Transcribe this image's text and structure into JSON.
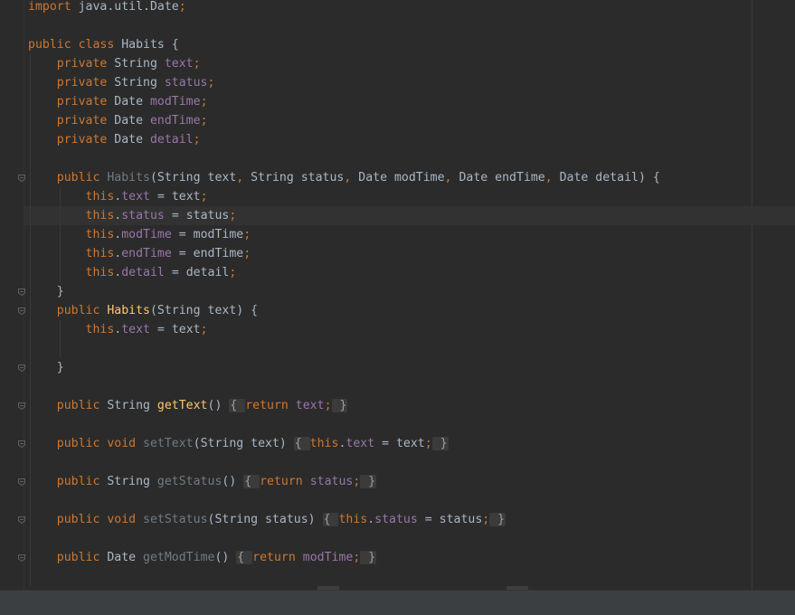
{
  "editor": {
    "lines": [
      [
        {
          "t": "import",
          "c": "kw"
        },
        {
          "t": " java.util.Date",
          "c": "pl"
        },
        {
          "t": ";",
          "c": "kw"
        }
      ],
      [],
      [
        {
          "t": "public class",
          "c": "kw"
        },
        {
          "t": " Habits {",
          "c": "pl"
        }
      ],
      [
        {
          "t": "    private ",
          "c": "kw"
        },
        {
          "t": "String ",
          "c": "pl"
        },
        {
          "t": "text",
          "c": "fld"
        },
        {
          "t": ";",
          "c": "kw"
        }
      ],
      [
        {
          "t": "    private ",
          "c": "kw"
        },
        {
          "t": "String ",
          "c": "pl"
        },
        {
          "t": "status",
          "c": "fld"
        },
        {
          "t": ";",
          "c": "kw"
        }
      ],
      [
        {
          "t": "    private ",
          "c": "kw"
        },
        {
          "t": "Date ",
          "c": "pl"
        },
        {
          "t": "modTime",
          "c": "fld"
        },
        {
          "t": ";",
          "c": "kw"
        }
      ],
      [
        {
          "t": "    private ",
          "c": "kw"
        },
        {
          "t": "Date ",
          "c": "pl"
        },
        {
          "t": "endTime",
          "c": "fld"
        },
        {
          "t": ";",
          "c": "kw"
        }
      ],
      [
        {
          "t": "    private ",
          "c": "kw"
        },
        {
          "t": "Date ",
          "c": "pl"
        },
        {
          "t": "detail",
          "c": "fld"
        },
        {
          "t": ";",
          "c": "kw"
        }
      ],
      [],
      [
        {
          "t": "    public ",
          "c": "kw"
        },
        {
          "t": "Habits",
          "c": "dim"
        },
        {
          "t": "(String text",
          "c": "pl"
        },
        {
          "t": ", ",
          "c": "kw"
        },
        {
          "t": "String status",
          "c": "pl"
        },
        {
          "t": ", ",
          "c": "kw"
        },
        {
          "t": "Date modTime",
          "c": "pl"
        },
        {
          "t": ", ",
          "c": "kw"
        },
        {
          "t": "Date endTime",
          "c": "pl"
        },
        {
          "t": ", ",
          "c": "kw"
        },
        {
          "t": "Date detail) {",
          "c": "pl"
        }
      ],
      [
        {
          "t": "        this",
          "c": "kw"
        },
        {
          "t": ".",
          "c": "pl"
        },
        {
          "t": "text",
          "c": "fld"
        },
        {
          "t": " = text",
          "c": "pl"
        },
        {
          "t": ";",
          "c": "kw"
        }
      ],
      [
        {
          "t": "        this",
          "c": "kw"
        },
        {
          "t": ".",
          "c": "pl"
        },
        {
          "t": "status",
          "c": "fld"
        },
        {
          "t": " = status",
          "c": "pl"
        },
        {
          "t": ";",
          "c": "kw"
        }
      ],
      [
        {
          "t": "        this",
          "c": "kw"
        },
        {
          "t": ".",
          "c": "pl"
        },
        {
          "t": "modTime",
          "c": "fld"
        },
        {
          "t": " = modTime",
          "c": "pl"
        },
        {
          "t": ";",
          "c": "kw"
        }
      ],
      [
        {
          "t": "        this",
          "c": "kw"
        },
        {
          "t": ".",
          "c": "pl"
        },
        {
          "t": "endTime",
          "c": "fld"
        },
        {
          "t": " = endTime",
          "c": "pl"
        },
        {
          "t": ";",
          "c": "kw"
        }
      ],
      [
        {
          "t": "        this",
          "c": "kw"
        },
        {
          "t": ".",
          "c": "pl"
        },
        {
          "t": "detail",
          "c": "fld"
        },
        {
          "t": " = detail",
          "c": "pl"
        },
        {
          "t": ";",
          "c": "kw"
        }
      ],
      [
        {
          "t": "    }",
          "c": "pl"
        }
      ],
      [
        {
          "t": "    public ",
          "c": "kw"
        },
        {
          "t": "Habits",
          "c": "fn"
        },
        {
          "t": "(String text) {",
          "c": "pl"
        }
      ],
      [
        {
          "t": "        this",
          "c": "kw"
        },
        {
          "t": ".",
          "c": "pl"
        },
        {
          "t": "text",
          "c": "fld"
        },
        {
          "t": " = text",
          "c": "pl"
        },
        {
          "t": ";",
          "c": "kw"
        }
      ],
      [],
      [
        {
          "t": "    }",
          "c": "pl"
        }
      ],
      [],
      [
        {
          "t": "    public ",
          "c": "kw"
        },
        {
          "t": "String ",
          "c": "pl"
        },
        {
          "t": "getText",
          "c": "fn"
        },
        {
          "t": "() ",
          "c": "pl"
        },
        {
          "t": "{ ",
          "c": "fold"
        },
        {
          "t": "return ",
          "c": "kw"
        },
        {
          "t": "text",
          "c": "fld"
        },
        {
          "t": ";",
          "c": "kw"
        },
        {
          "t": " }",
          "c": "fold"
        }
      ],
      [],
      [
        {
          "t": "    public void ",
          "c": "kw"
        },
        {
          "t": "setText",
          "c": "dim"
        },
        {
          "t": "(String text) ",
          "c": "pl"
        },
        {
          "t": "{ ",
          "c": "fold"
        },
        {
          "t": "this",
          "c": "kw"
        },
        {
          "t": ".",
          "c": "pl"
        },
        {
          "t": "text",
          "c": "fld"
        },
        {
          "t": " = text",
          "c": "pl"
        },
        {
          "t": ";",
          "c": "kw"
        },
        {
          "t": " }",
          "c": "fold"
        }
      ],
      [],
      [
        {
          "t": "    public ",
          "c": "kw"
        },
        {
          "t": "String ",
          "c": "pl"
        },
        {
          "t": "getStatus",
          "c": "dim"
        },
        {
          "t": "() ",
          "c": "pl"
        },
        {
          "t": "{ ",
          "c": "fold"
        },
        {
          "t": "return ",
          "c": "kw"
        },
        {
          "t": "status",
          "c": "fld"
        },
        {
          "t": ";",
          "c": "kw"
        },
        {
          "t": " }",
          "c": "fold"
        }
      ],
      [],
      [
        {
          "t": "    public void ",
          "c": "kw"
        },
        {
          "t": "setStatus",
          "c": "dim"
        },
        {
          "t": "(String status) ",
          "c": "pl"
        },
        {
          "t": "{ ",
          "c": "fold"
        },
        {
          "t": "this",
          "c": "kw"
        },
        {
          "t": ".",
          "c": "pl"
        },
        {
          "t": "status",
          "c": "fld"
        },
        {
          "t": " = status",
          "c": "pl"
        },
        {
          "t": ";",
          "c": "kw"
        },
        {
          "t": " }",
          "c": "fold"
        }
      ],
      [],
      [
        {
          "t": "    public ",
          "c": "kw"
        },
        {
          "t": "Date ",
          "c": "pl"
        },
        {
          "t": "getModTime",
          "c": "dim"
        },
        {
          "t": "() ",
          "c": "pl"
        },
        {
          "t": "{ ",
          "c": "fold"
        },
        {
          "t": "return ",
          "c": "kw"
        },
        {
          "t": "modTime",
          "c": "fld"
        },
        {
          "t": ";",
          "c": "kw"
        },
        {
          "t": " }",
          "c": "fold"
        }
      ]
    ],
    "highlighted_line": 11,
    "fold_markers": [
      9,
      15,
      16,
      19,
      21,
      23,
      25,
      27,
      29
    ]
  },
  "colors": {
    "background": "#2b2b2b",
    "keyword": "#cc7832",
    "field": "#9876aa",
    "method": "#ffc66d",
    "plain": "#a9b7c6",
    "unused": "#727a84"
  },
  "icons": {
    "fold_marker": "fold-minus-icon"
  }
}
